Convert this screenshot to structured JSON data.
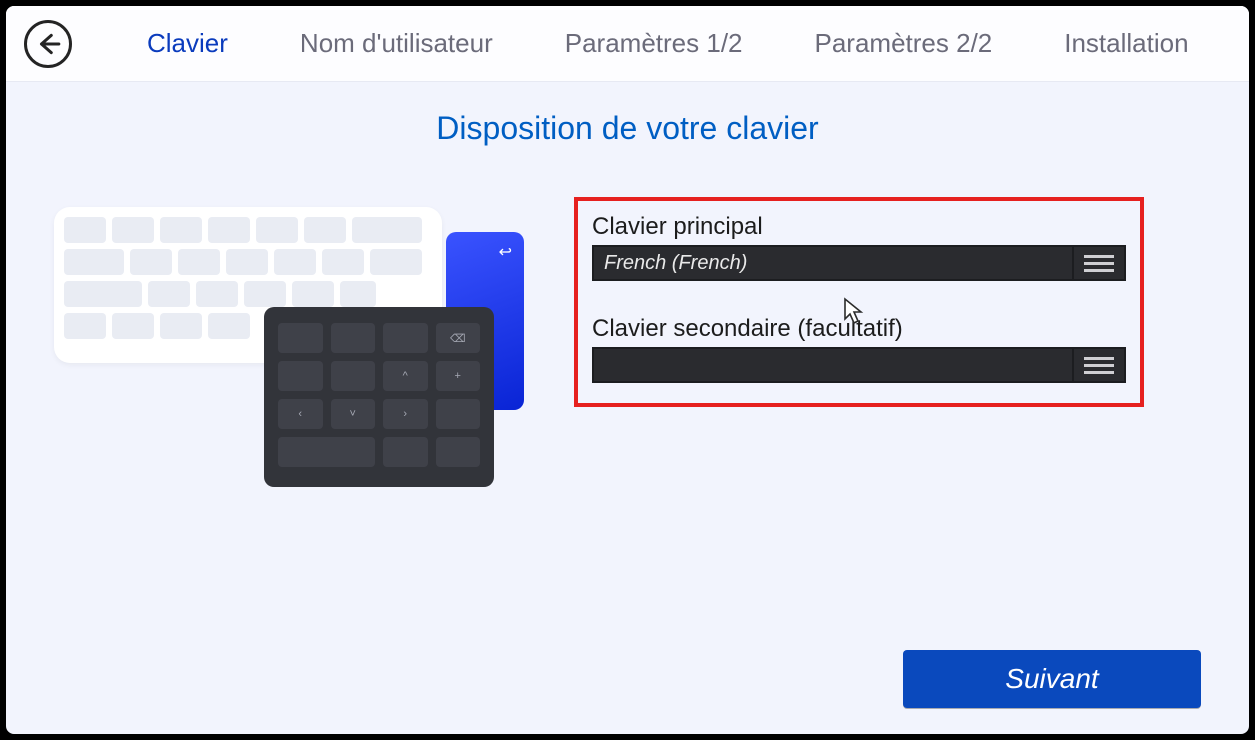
{
  "colors": {
    "accent": "#0a49bd",
    "highlight": "#e6201f"
  },
  "topbar": {
    "steps": [
      {
        "label": "Clavier",
        "active": true
      },
      {
        "label": "Nom d'utilisateur",
        "active": false
      },
      {
        "label": "Paramètres 1/2",
        "active": false
      },
      {
        "label": "Paramètres 2/2",
        "active": false
      },
      {
        "label": "Installation",
        "active": false
      }
    ]
  },
  "page": {
    "title": "Disposition de votre clavier"
  },
  "form": {
    "primary_label": "Clavier principal",
    "primary_value": "French (French)",
    "secondary_label": "Clavier secondaire (facultatif)",
    "secondary_value": ""
  },
  "buttons": {
    "next": "Suivant"
  },
  "icons": {
    "back": "arrow-left-icon",
    "enter": "↩",
    "menu": "hamburger-icon",
    "cursor": "cursor-icon"
  }
}
